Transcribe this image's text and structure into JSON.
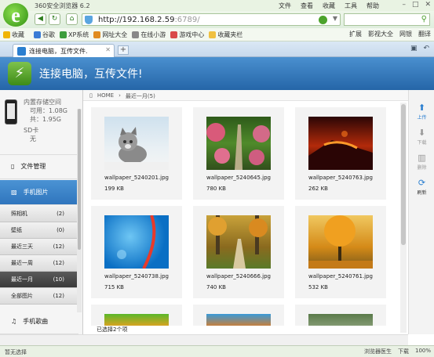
{
  "browser": {
    "title": "360安全浏览器 6.2",
    "menus": [
      "文件",
      "查看",
      "收藏",
      "工具",
      "帮助"
    ],
    "url_main": "http://192.168.2.59",
    "url_port": ":6789/",
    "favorites_label": "收藏",
    "favorites": [
      "谷歌",
      "XP系统",
      "网址大全",
      "在线小游",
      "游戏中心",
      "收藏夹栏"
    ],
    "fav_right": [
      "扩展",
      "影视大全",
      "网银",
      "翻译"
    ],
    "tab_title": "连接电脑，互传文件.",
    "status_left": "暂无选择",
    "status_right": [
      "浏览器医生",
      "下载",
      "100%"
    ]
  },
  "app": {
    "header_title": "连接电脑，互传文件!",
    "storage": {
      "internal_label": "内置存储空间",
      "available": "可用：1.08G",
      "total": "共：1.95G",
      "sd_label": "SD卡",
      "sd_value": "无"
    },
    "nav": {
      "file_manage": "文件管理",
      "photos": "手机图片",
      "music": "手机歌曲"
    },
    "photo_categories": [
      {
        "label": "照相机",
        "count": "(2)"
      },
      {
        "label": "壁纸",
        "count": "(0)"
      },
      {
        "label": "最近三天",
        "count": "(12)"
      },
      {
        "label": "最近一周",
        "count": "(12)"
      },
      {
        "label": "最近一月",
        "count": "(10)"
      },
      {
        "label": "全部图片",
        "count": "(12)"
      }
    ],
    "breadcrumb": {
      "home": "HOME",
      "current": "最近一月(5)"
    },
    "files": [
      {
        "name": "wallpaper_5240201.jpg",
        "size": "199 KB"
      },
      {
        "name": "wallpaper_5240645.jpg",
        "size": "780 KB"
      },
      {
        "name": "wallpaper_5240763.jpg",
        "size": "262 KB"
      },
      {
        "name": "wallpaper_5240738.jpg",
        "size": "715 KB"
      },
      {
        "name": "wallpaper_5240666.jpg",
        "size": "740 KB"
      },
      {
        "name": "wallpaper_5240761.jpg",
        "size": "532 KB"
      }
    ],
    "selection_status": "已选择2个项",
    "tools": [
      "上传",
      "下载",
      "删除",
      "刷新"
    ]
  }
}
